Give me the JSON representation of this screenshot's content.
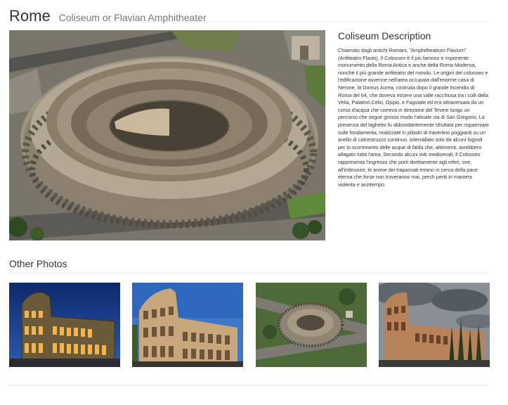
{
  "header": {
    "title": "Rome",
    "subtitle": "Coliseum or Flavian Amphitheater"
  },
  "description": {
    "heading": "Coliseum Description",
    "text": "Chiamato dagli antichi Romani, \"Amphitheatrum Flavium\" (Anfiteatro Flavio), Il Colosseo è il più famoso e imponente monumento della Roma Antica e anche della Roma Moderna, nonché il più grande anfiteatro del mondo. Le origini del colosseo e l'edificazione avvenne nell'area occupata dall'enorme casa di Nerone, la Domus Aurea, costruita dopo il grande Incendio di Roma del 64, che doveva essere una valle racchiusa tra i colli della Velia, Palatino,Celio, Oppio, e Fagutale ed era attraversata da un corso d'acqua che correva in direzione del Tevere lungo un percorso che segue grosso modo l'attuale via di San Gregorio. La presenza del laghetto fu abbondantemente sfruttata per risparmiare sulle fondamenta, realizzate in pilastri di travertino poggianti su un anello di calcestruzzo continuo, intervallato solo da alcuni fognoli per lo scorrimento delle acque di falda che, altrimenti, avrebbero allagato tutta l'area. Secondo alcuni miti medioevali, Il Colosseo rappresenta l'ingresso che porti direttamente agli inferi, ove, all'imbrunire, le anime dei trapassati errano in cerca della pace eterna che forse non troveranno mai, perch periti in maniera violenta e anzitempo."
  },
  "other_photos": {
    "heading": "Other Photos"
  }
}
